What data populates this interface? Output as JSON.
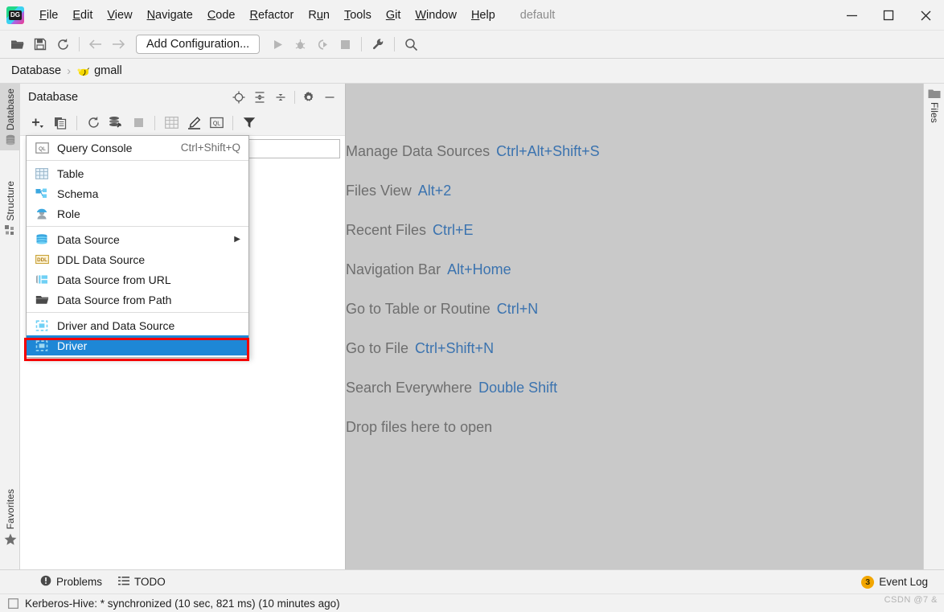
{
  "window": {
    "app_logo": "datagrip-logo-icon",
    "profile_label": "default",
    "controls": {
      "minimize": "minimize-icon",
      "maximize": "maximize-icon",
      "close": "close-icon"
    }
  },
  "menubar": {
    "items": [
      {
        "label": "File"
      },
      {
        "label": "Edit"
      },
      {
        "label": "View"
      },
      {
        "label": "Navigate"
      },
      {
        "label": "Code"
      },
      {
        "label": "Refactor"
      },
      {
        "label": "Run"
      },
      {
        "label": "Tools"
      },
      {
        "label": "Git"
      },
      {
        "label": "Window"
      },
      {
        "label": "Help"
      }
    ]
  },
  "toolbar": {
    "open_icon": "open-folder-icon",
    "save_icon": "save-icon",
    "sync_icon": "refresh-icon",
    "back_icon": "arrow-left-icon",
    "forward_icon": "arrow-right-icon",
    "run_configuration": "Add Configuration...",
    "run_icon": "run-play-icon",
    "debug_icon": "debug-bug-icon",
    "run_coverage_icon": "run-with-coverage-icon",
    "stop_icon": "stop-square-icon",
    "settings_icon": "wrench-icon",
    "search_icon": "search-icon"
  },
  "breadcrumb": {
    "root": "Database",
    "separator": "›",
    "db_icon": "hive-bee-icon",
    "current": "gmall"
  },
  "left_strip": {
    "tabs": [
      {
        "label": "Database",
        "icon": "database-icon",
        "active": true
      },
      {
        "label": "Structure",
        "icon": "structure-icon",
        "active": false
      }
    ],
    "bottom_tabs": [
      {
        "label": "Favorites",
        "icon": "star-icon",
        "active": false
      }
    ]
  },
  "right_strip": {
    "tabs": [
      {
        "label": "Files",
        "icon": "folder-icon",
        "active": false
      }
    ]
  },
  "database_panel": {
    "title": "Database",
    "header_icons": [
      {
        "name": "locate-target-icon"
      },
      {
        "name": "expand-all-icon"
      },
      {
        "name": "collapse-all-icon"
      },
      {
        "name": "gear-icon"
      },
      {
        "name": "hide-minus-icon"
      }
    ],
    "toolbar_icons": [
      {
        "name": "add-plus-icon"
      },
      {
        "name": "copy-icon"
      },
      {
        "name": "refresh-icon"
      },
      {
        "name": "sync-settings-icon"
      },
      {
        "name": "stop-square-icon"
      },
      {
        "name": "table-icon"
      },
      {
        "name": "edit-pencil-icon"
      },
      {
        "name": "query-console-icon"
      },
      {
        "name": "filter-icon"
      }
    ]
  },
  "popup_menu": {
    "groups": [
      {
        "items": [
          {
            "label": "Query Console",
            "shortcut": "Ctrl+Shift+Q",
            "icon": "query-console-icon",
            "selected": false,
            "submenu": false
          }
        ]
      },
      {
        "items": [
          {
            "label": "Table",
            "shortcut": "",
            "icon": "table-icon",
            "selected": false,
            "submenu": false
          },
          {
            "label": "Schema",
            "shortcut": "",
            "icon": "schema-icon",
            "selected": false,
            "submenu": false
          },
          {
            "label": "Role",
            "shortcut": "",
            "icon": "role-user-icon",
            "selected": false,
            "submenu": false
          }
        ]
      },
      {
        "items": [
          {
            "label": "Data Source",
            "shortcut": "",
            "icon": "data-source-icon",
            "selected": false,
            "submenu": true
          },
          {
            "label": "DDL Data Source",
            "shortcut": "",
            "icon": "ddl-data-source-icon",
            "selected": false,
            "submenu": false
          },
          {
            "label": "Data Source from URL",
            "shortcut": "",
            "icon": "data-source-url-icon",
            "selected": false,
            "submenu": false
          },
          {
            "label": "Data Source from Path",
            "shortcut": "",
            "icon": "data-source-path-icon",
            "selected": false,
            "submenu": false
          }
        ]
      },
      {
        "items": [
          {
            "label": "Driver and Data Source",
            "shortcut": "",
            "icon": "driver-icon",
            "selected": false,
            "submenu": false
          },
          {
            "label": "Driver",
            "shortcut": "",
            "icon": "driver-icon",
            "selected": true,
            "submenu": false
          }
        ]
      }
    ],
    "submenu_arrow": "▶",
    "highlight_color": "#1e87d6",
    "annotation_box_color": "#f40000"
  },
  "editor_hints": {
    "rows": [
      {
        "text": "Manage Data Sources",
        "key": "Ctrl+Alt+Shift+S"
      },
      {
        "text": "Files View",
        "key": "Alt+2"
      },
      {
        "text": "Recent Files",
        "key": "Ctrl+E"
      },
      {
        "text": "Navigation Bar",
        "key": "Alt+Home"
      },
      {
        "text": "Go to Table or Routine",
        "key": "Ctrl+N"
      },
      {
        "text": "Go to File",
        "key": "Ctrl+Shift+N"
      },
      {
        "text": "Search Everywhere",
        "key": "Double Shift"
      },
      {
        "text": "Drop files here to open",
        "key": ""
      }
    ]
  },
  "bottom_strip": {
    "buttons": [
      {
        "label": "Problems",
        "icon": "problems-icon"
      },
      {
        "label": "TODO",
        "icon": "todo-list-icon"
      }
    ],
    "event_log": {
      "label": "Event Log",
      "count": "3",
      "badge_color": "#f2a600"
    }
  },
  "status_bar": {
    "icon": "window-indicator-icon",
    "message": "Kerberos-Hive: * synchronized (10 sec, 821 ms) (10 minutes ago)"
  },
  "watermark": {
    "text": "CSDN @7 &"
  }
}
